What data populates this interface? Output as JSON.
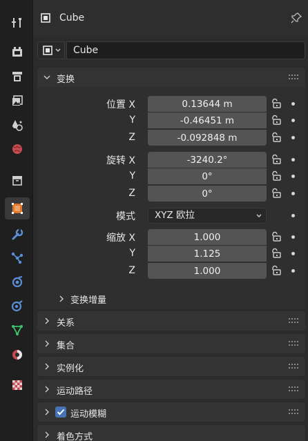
{
  "header": {
    "title": "Cube",
    "object_icon": "object-icon",
    "pin_icon": "pin-icon"
  },
  "name_field": {
    "value": "Cube",
    "type_icon": "object-data-icon"
  },
  "transform": {
    "title": "变换",
    "location": {
      "label": "位置",
      "x_label": "X",
      "y_label": "Y",
      "z_label": "Z",
      "x": "0.13644 m",
      "y": "-0.46451 m",
      "z": "-0.092848 m"
    },
    "rotation": {
      "label": "旋转",
      "x_label": "X",
      "y_label": "Y",
      "z_label": "Z",
      "x": "-3240.2°",
      "y": "0°",
      "z": "0°"
    },
    "mode": {
      "label": "模式",
      "value": "XYZ 欧拉"
    },
    "scale": {
      "label": "缩放",
      "x_label": "X",
      "y_label": "Y",
      "z_label": "Z",
      "x": "1.000",
      "y": "1.125",
      "z": "1.000"
    },
    "delta": {
      "label": "变换增量"
    }
  },
  "panels": [
    {
      "label": "关系"
    },
    {
      "label": "集合"
    },
    {
      "label": "实例化"
    },
    {
      "label": "运动路径"
    },
    {
      "label": "运动模糊",
      "checked": true
    },
    {
      "label": "着色方式"
    }
  ],
  "sidebar_tabs": [
    "tool-icon",
    "render-icon",
    "output-icon",
    "view-layer-icon",
    "scene-icon",
    "world-icon",
    "collection-icon",
    "object-icon",
    "modifier-icon",
    "particles-icon",
    "physics-icon",
    "constraints-icon",
    "object-data-icon",
    "material-icon",
    "texture-icon"
  ],
  "colors": {
    "accent": "#4772b3",
    "active_tab": "#e0762c",
    "panel": "#2f2f2f",
    "field": "#545454"
  }
}
